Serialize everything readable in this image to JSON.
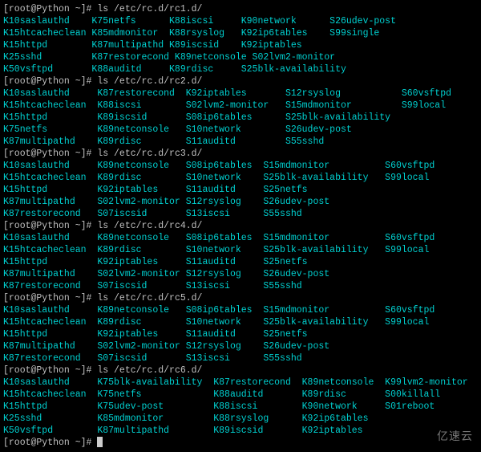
{
  "prompt": "[root@Python ~]#",
  "sections": [
    {
      "cmd": "ls /etc/rc.d/rc1.d/",
      "rows": [
        [
          {
            "t": "K10saslauthd",
            "w": 15
          },
          {
            "t": "K75netfs",
            "w": 13
          },
          {
            "t": "K88iscsi",
            "w": 12
          },
          {
            "t": "K90network",
            "w": 15
          },
          {
            "t": "S26udev-post",
            "w": 0
          }
        ],
        [
          {
            "t": "K15htcacheclean",
            "w": 15
          },
          {
            "t": "K85mdmonitor",
            "w": 13
          },
          {
            "t": "K88rsyslog",
            "w": 12
          },
          {
            "t": "K92ip6tables",
            "w": 15
          },
          {
            "t": "S99single",
            "w": 0
          }
        ],
        [
          {
            "t": "K15httpd",
            "w": 15
          },
          {
            "t": "K87multipathd",
            "w": 13
          },
          {
            "t": "K89iscsid",
            "w": 12
          },
          {
            "t": "K92iptables",
            "w": 0
          }
        ],
        [
          {
            "t": "K25sshd",
            "w": 15
          },
          {
            "t": "K87restorecond",
            "w": 13
          },
          {
            "t": "K89netconsole",
            "w": 12
          },
          {
            "t": "S02lvm2-monitor",
            "w": 0
          }
        ],
        [
          {
            "t": "K50vsftpd",
            "w": 15
          },
          {
            "t": "K88auditd",
            "w": 13
          },
          {
            "t": "K89rdisc",
            "w": 12
          },
          {
            "t": "S25blk-availability",
            "w": 0
          }
        ]
      ]
    },
    {
      "cmd": "ls /etc/rc.d/rc2.d/",
      "rows": [
        [
          {
            "t": "K10saslauthd",
            "w": 16
          },
          {
            "t": "K87restorecond",
            "w": 15
          },
          {
            "t": "K92iptables",
            "w": 17
          },
          {
            "t": "S12rsyslog",
            "w": 20
          },
          {
            "t": "S60vsftpd",
            "w": 0
          }
        ],
        [
          {
            "t": "K15htcacheclean",
            "w": 16
          },
          {
            "t": "K88iscsi",
            "w": 15
          },
          {
            "t": "S02lvm2-monitor",
            "w": 17
          },
          {
            "t": "S15mdmonitor",
            "w": 20
          },
          {
            "t": "S99local",
            "w": 0
          }
        ],
        [
          {
            "t": "K15httpd",
            "w": 16
          },
          {
            "t": "K89iscsid",
            "w": 15
          },
          {
            "t": "S08ip6tables",
            "w": 17
          },
          {
            "t": "S25blk-availability",
            "w": 0
          }
        ],
        [
          {
            "t": "K75netfs",
            "w": 16
          },
          {
            "t": "K89netconsole",
            "w": 15
          },
          {
            "t": "S10network",
            "w": 17
          },
          {
            "t": "S26udev-post",
            "w": 0
          }
        ],
        [
          {
            "t": "K87multipathd",
            "w": 16
          },
          {
            "t": "K89rdisc",
            "w": 15
          },
          {
            "t": "S11auditd",
            "w": 17
          },
          {
            "t": "S55sshd",
            "w": 0
          }
        ]
      ]
    },
    {
      "cmd": "ls /etc/rc.d/rc3.d/",
      "rows": [
        [
          {
            "t": "K10saslauthd",
            "w": 16
          },
          {
            "t": "K89netconsole",
            "w": 15
          },
          {
            "t": "S08ip6tables",
            "w": 13
          },
          {
            "t": "S15mdmonitor",
            "w": 21
          },
          {
            "t": "S60vsftpd",
            "w": 0
          }
        ],
        [
          {
            "t": "K15htcacheclean",
            "w": 16
          },
          {
            "t": "K89rdisc",
            "w": 15
          },
          {
            "t": "S10network",
            "w": 13
          },
          {
            "t": "S25blk-availability",
            "w": 21
          },
          {
            "t": "S99local",
            "w": 0
          }
        ],
        [
          {
            "t": "K15httpd",
            "w": 16
          },
          {
            "t": "K92iptables",
            "w": 15
          },
          {
            "t": "S11auditd",
            "w": 13
          },
          {
            "t": "S25netfs",
            "w": 0
          }
        ],
        [
          {
            "t": "K87multipathd",
            "w": 16
          },
          {
            "t": "S02lvm2-monitor",
            "w": 15
          },
          {
            "t": "S12rsyslog",
            "w": 13
          },
          {
            "t": "S26udev-post",
            "w": 0
          }
        ],
        [
          {
            "t": "K87restorecond",
            "w": 16
          },
          {
            "t": "S07iscsid",
            "w": 15
          },
          {
            "t": "S13iscsi",
            "w": 13
          },
          {
            "t": "S55sshd",
            "w": 0
          }
        ]
      ]
    },
    {
      "cmd": "ls /etc/rc.d/rc4.d/",
      "rows": [
        [
          {
            "t": "K10saslauthd",
            "w": 16
          },
          {
            "t": "K89netconsole",
            "w": 15
          },
          {
            "t": "S08ip6tables",
            "w": 13
          },
          {
            "t": "S15mdmonitor",
            "w": 21
          },
          {
            "t": "S60vsftpd",
            "w": 0
          }
        ],
        [
          {
            "t": "K15htcacheclean",
            "w": 16
          },
          {
            "t": "K89rdisc",
            "w": 15
          },
          {
            "t": "S10network",
            "w": 13
          },
          {
            "t": "S25blk-availability",
            "w": 21
          },
          {
            "t": "S99local",
            "w": 0
          }
        ],
        [
          {
            "t": "K15httpd",
            "w": 16
          },
          {
            "t": "K92iptables",
            "w": 15
          },
          {
            "t": "S11auditd",
            "w": 13
          },
          {
            "t": "S25netfs",
            "w": 0
          }
        ],
        [
          {
            "t": "K87multipathd",
            "w": 16
          },
          {
            "t": "S02lvm2-monitor",
            "w": 15
          },
          {
            "t": "S12rsyslog",
            "w": 13
          },
          {
            "t": "S26udev-post",
            "w": 0
          }
        ],
        [
          {
            "t": "K87restorecond",
            "w": 16
          },
          {
            "t": "S07iscsid",
            "w": 15
          },
          {
            "t": "S13iscsi",
            "w": 13
          },
          {
            "t": "S55sshd",
            "w": 0
          }
        ]
      ]
    },
    {
      "cmd": "ls /etc/rc.d/rc5.d/",
      "rows": [
        [
          {
            "t": "K10saslauthd",
            "w": 16
          },
          {
            "t": "K89netconsole",
            "w": 15
          },
          {
            "t": "S08ip6tables",
            "w": 13
          },
          {
            "t": "S15mdmonitor",
            "w": 21
          },
          {
            "t": "S60vsftpd",
            "w": 0
          }
        ],
        [
          {
            "t": "K15htcacheclean",
            "w": 16
          },
          {
            "t": "K89rdisc",
            "w": 15
          },
          {
            "t": "S10network",
            "w": 13
          },
          {
            "t": "S25blk-availability",
            "w": 21
          },
          {
            "t": "S99local",
            "w": 0
          }
        ],
        [
          {
            "t": "K15httpd",
            "w": 16
          },
          {
            "t": "K92iptables",
            "w": 15
          },
          {
            "t": "S11auditd",
            "w": 13
          },
          {
            "t": "S25netfs",
            "w": 0
          }
        ],
        [
          {
            "t": "K87multipathd",
            "w": 16
          },
          {
            "t": "S02lvm2-monitor",
            "w": 15
          },
          {
            "t": "S12rsyslog",
            "w": 13
          },
          {
            "t": "S26udev-post",
            "w": 0
          }
        ],
        [
          {
            "t": "K87restorecond",
            "w": 16
          },
          {
            "t": "S07iscsid",
            "w": 15
          },
          {
            "t": "S13iscsi",
            "w": 13
          },
          {
            "t": "S55sshd",
            "w": 0
          }
        ]
      ]
    },
    {
      "cmd": "ls /etc/rc.d/rc6.d/",
      "rows": [
        [
          {
            "t": "K10saslauthd",
            "w": 16
          },
          {
            "t": "K75blk-availability",
            "w": 20
          },
          {
            "t": "K87restorecond",
            "w": 15
          },
          {
            "t": "K89netconsole",
            "w": 14
          },
          {
            "t": "K99lvm2-monitor",
            "w": 0
          }
        ],
        [
          {
            "t": "K15htcacheclean",
            "w": 16
          },
          {
            "t": "K75netfs",
            "w": 20
          },
          {
            "t": "K88auditd",
            "w": 15
          },
          {
            "t": "K89rdisc",
            "w": 14
          },
          {
            "t": "S00killall",
            "w": 0
          }
        ],
        [
          {
            "t": "K15httpd",
            "w": 16
          },
          {
            "t": "K75udev-post",
            "w": 20
          },
          {
            "t": "K88iscsi",
            "w": 15
          },
          {
            "t": "K90network",
            "w": 14
          },
          {
            "t": "S01reboot",
            "w": 0
          }
        ],
        [
          {
            "t": "K25sshd",
            "w": 16
          },
          {
            "t": "K85mdmonitor",
            "w": 20
          },
          {
            "t": "K88rsyslog",
            "w": 15
          },
          {
            "t": "K92ip6tables",
            "w": 0
          }
        ],
        [
          {
            "t": "K50vsftpd",
            "w": 16
          },
          {
            "t": "K87multipathd",
            "w": 20
          },
          {
            "t": "K89iscsid",
            "w": 15
          },
          {
            "t": "K92iptables",
            "w": 0
          }
        ]
      ]
    }
  ],
  "watermark": "亿速云"
}
